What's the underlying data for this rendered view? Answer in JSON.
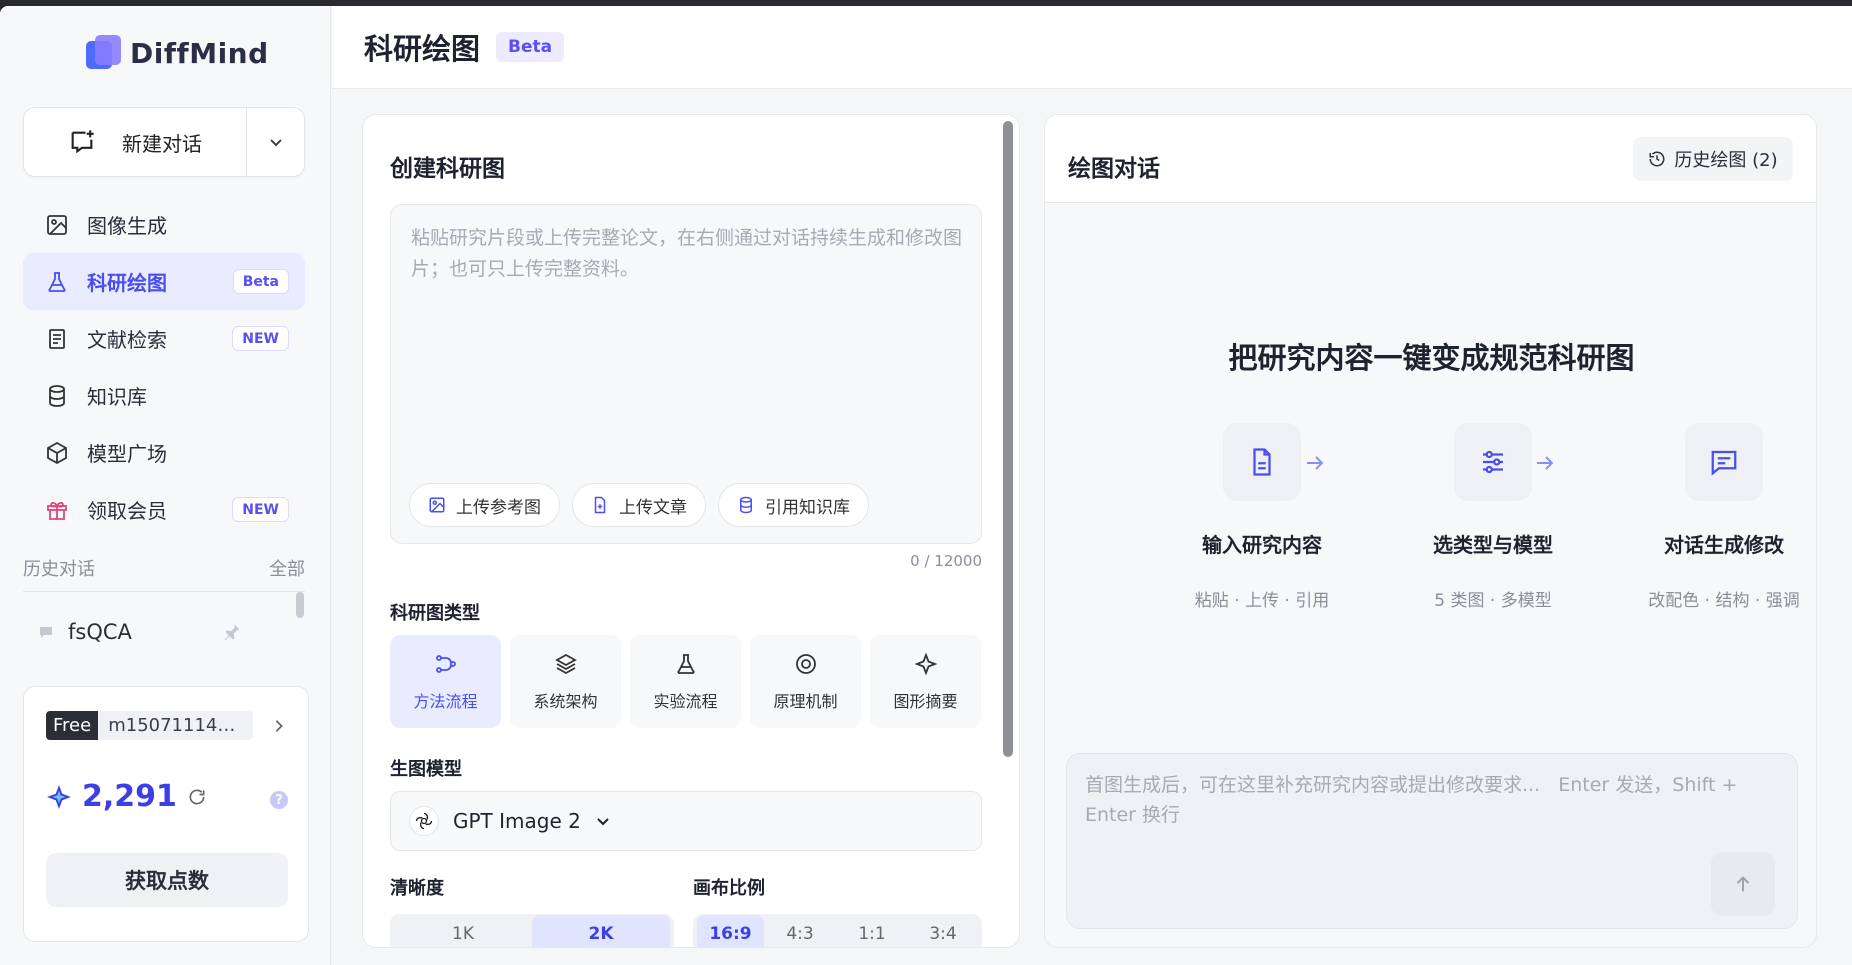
{
  "brand": {
    "name": "DiffMind"
  },
  "sidebar": {
    "new_chat": "新建对话",
    "items": [
      {
        "label": "图像生成",
        "icon": "image-icon",
        "badge": ""
      },
      {
        "label": "科研绘图",
        "icon": "flask-icon",
        "badge": "Beta"
      },
      {
        "label": "文献检索",
        "icon": "document-icon",
        "badge": "NEW"
      },
      {
        "label": "知识库",
        "icon": "database-icon",
        "badge": ""
      },
      {
        "label": "模型广场",
        "icon": "cube-icon",
        "badge": ""
      },
      {
        "label": "领取会员",
        "icon": "gift-icon",
        "badge": "NEW"
      }
    ],
    "history_title": "历史对话",
    "history_all": "全部",
    "history_items": [
      {
        "label": "fsQCA"
      }
    ],
    "account": {
      "plan": "Free",
      "user_id": "m15071114570...",
      "points": "2,291",
      "help": "?",
      "get_points": "获取点数"
    }
  },
  "header": {
    "title": "科研绘图",
    "badge": "Beta"
  },
  "create_panel": {
    "title": "创建科研图",
    "placeholder": "粘贴研究片段或上传完整论文，在右侧通过对话持续生成和修改图片；也可只上传完整资料。",
    "tools": [
      "上传参考图",
      "上传文章",
      "引用知识库"
    ],
    "char_count": "0 / 12000",
    "type_label": "科研图类型",
    "types": [
      {
        "label": "方法流程",
        "icon": "flow-icon"
      },
      {
        "label": "系统架构",
        "icon": "layers-icon"
      },
      {
        "label": "实验流程",
        "icon": "flask-icon"
      },
      {
        "label": "原理机制",
        "icon": "target-icon"
      },
      {
        "label": "图形摘要",
        "icon": "sparkle-icon"
      }
    ],
    "model_label": "生图模型",
    "model_value": "GPT Image 2",
    "resolution_label": "清晰度",
    "resolutions": [
      "1K",
      "2K"
    ],
    "ratio_label": "画布比例",
    "ratios": [
      "16:9",
      "4:3",
      "1:1",
      "3:4"
    ]
  },
  "chat_panel": {
    "title": "绘图对话",
    "history_button": "历史绘图 (2)",
    "hero": "把研究内容一键变成规范科研图",
    "steps": [
      {
        "title": "输入研究内容",
        "sub": "粘贴 · 上传 · 引用",
        "icon": "file-icon"
      },
      {
        "title": "选类型与模型",
        "sub": "5 类图 · 多模型",
        "icon": "sliders-icon"
      },
      {
        "title": "对话生成修改",
        "sub": "改配色 · 结构 · 强调",
        "icon": "message-icon"
      }
    ],
    "input_placeholder": "首图生成后，可在这里补充研究内容或提出修改要求...   Enter 发送，Shift + Enter 换行"
  },
  "colors": {
    "accent": "#4a4ef0",
    "accent_light": "#e9ebff"
  }
}
